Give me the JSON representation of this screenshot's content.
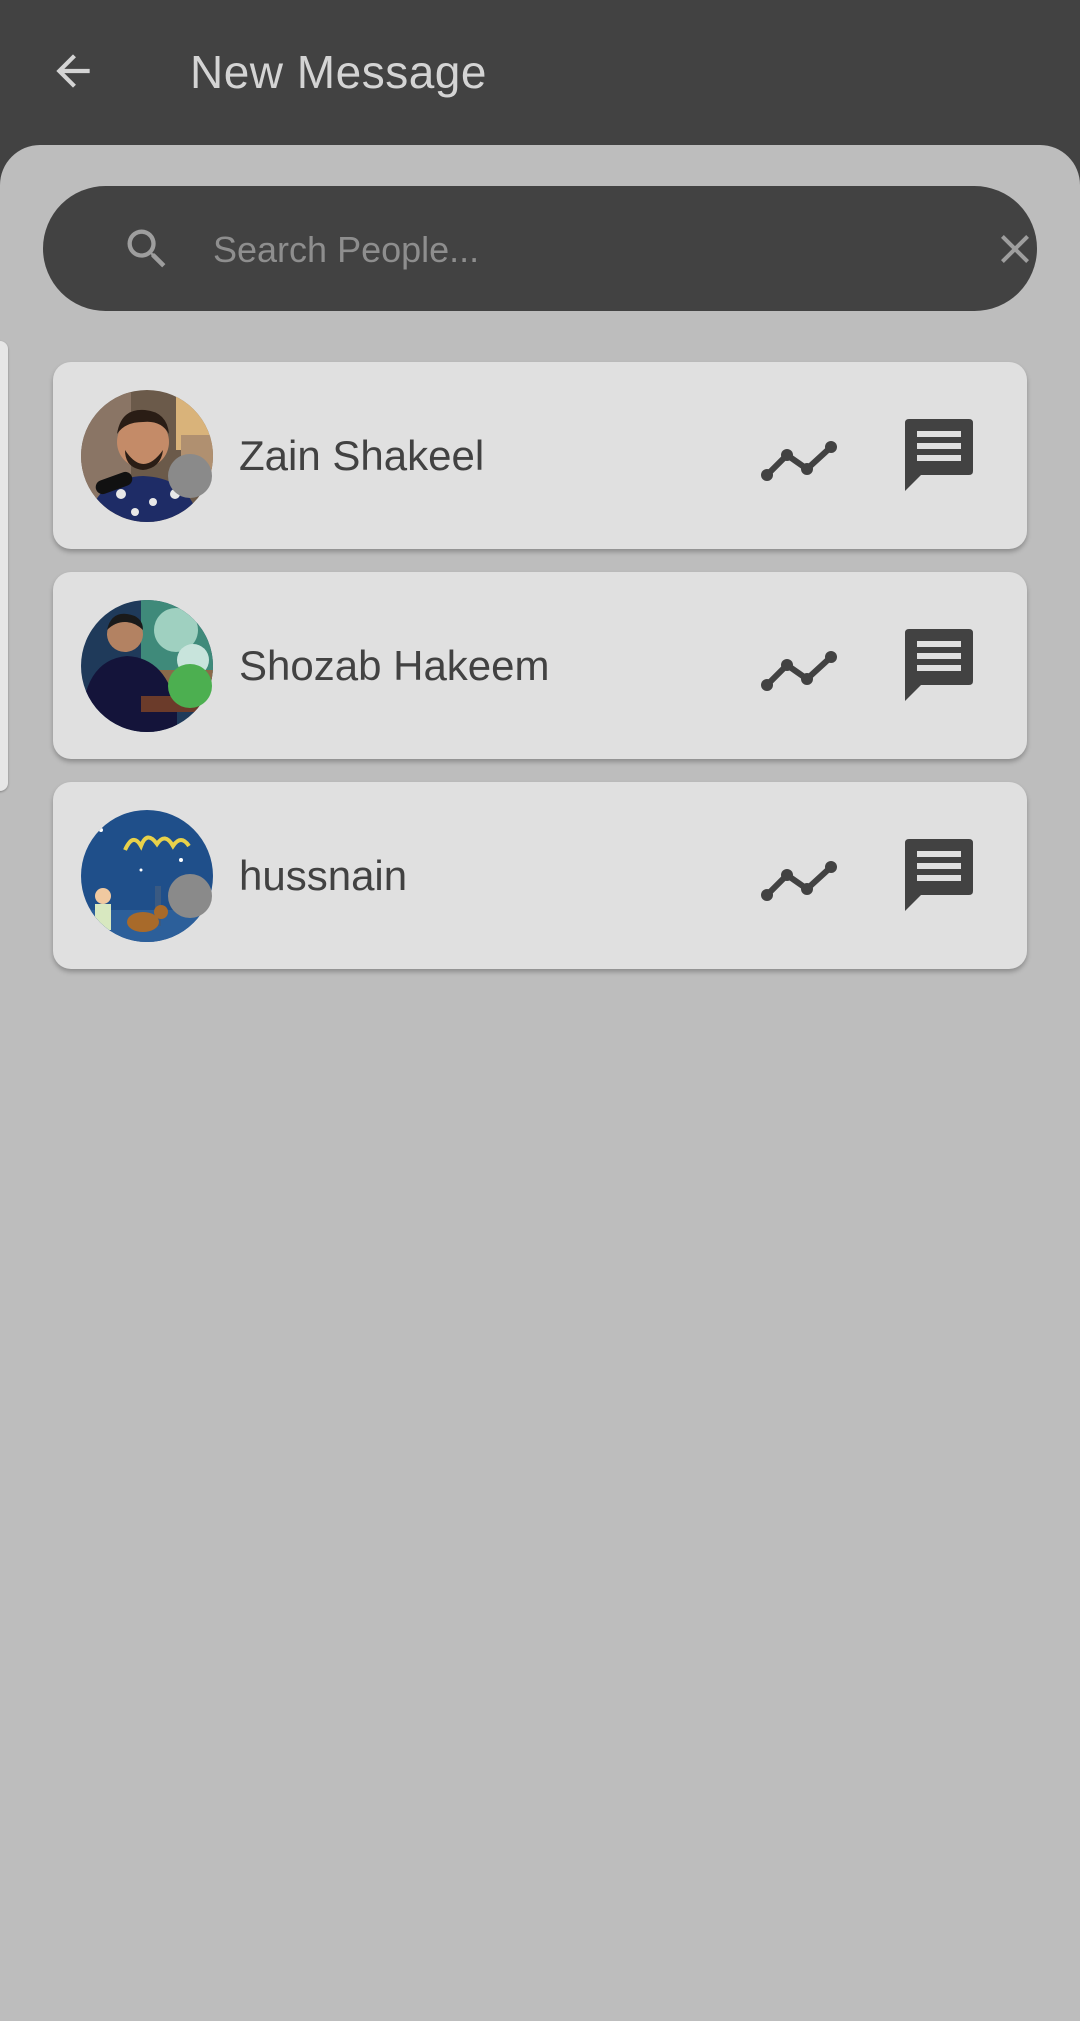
{
  "app_bar": {
    "title": "New Message",
    "back_icon": "arrow-left-icon"
  },
  "search": {
    "placeholder": "Search People...",
    "value": "",
    "search_icon": "search-icon",
    "clear_icon": "close-icon"
  },
  "contacts": [
    {
      "name": "Zain Shakeel",
      "status": "offline",
      "status_color": "#8a8a8a",
      "avatar": "photo-man-with-microphone"
    },
    {
      "name": "Shozab Hakeem",
      "status": "online",
      "status_color": "#4caf50",
      "avatar": "photo-man-sitting"
    },
    {
      "name": "hussnain",
      "status": "offline",
      "status_color": "#8a8a8a",
      "avatar": "eid-al-adha-illustration"
    }
  ],
  "row_icons": {
    "activity": "activity-chart-icon",
    "message": "message-icon"
  },
  "colors": {
    "app_bar": "#424242",
    "background": "#bdbdbd",
    "card": "#e0e0e0",
    "online": "#4caf50",
    "offline": "#8a8a8a"
  }
}
